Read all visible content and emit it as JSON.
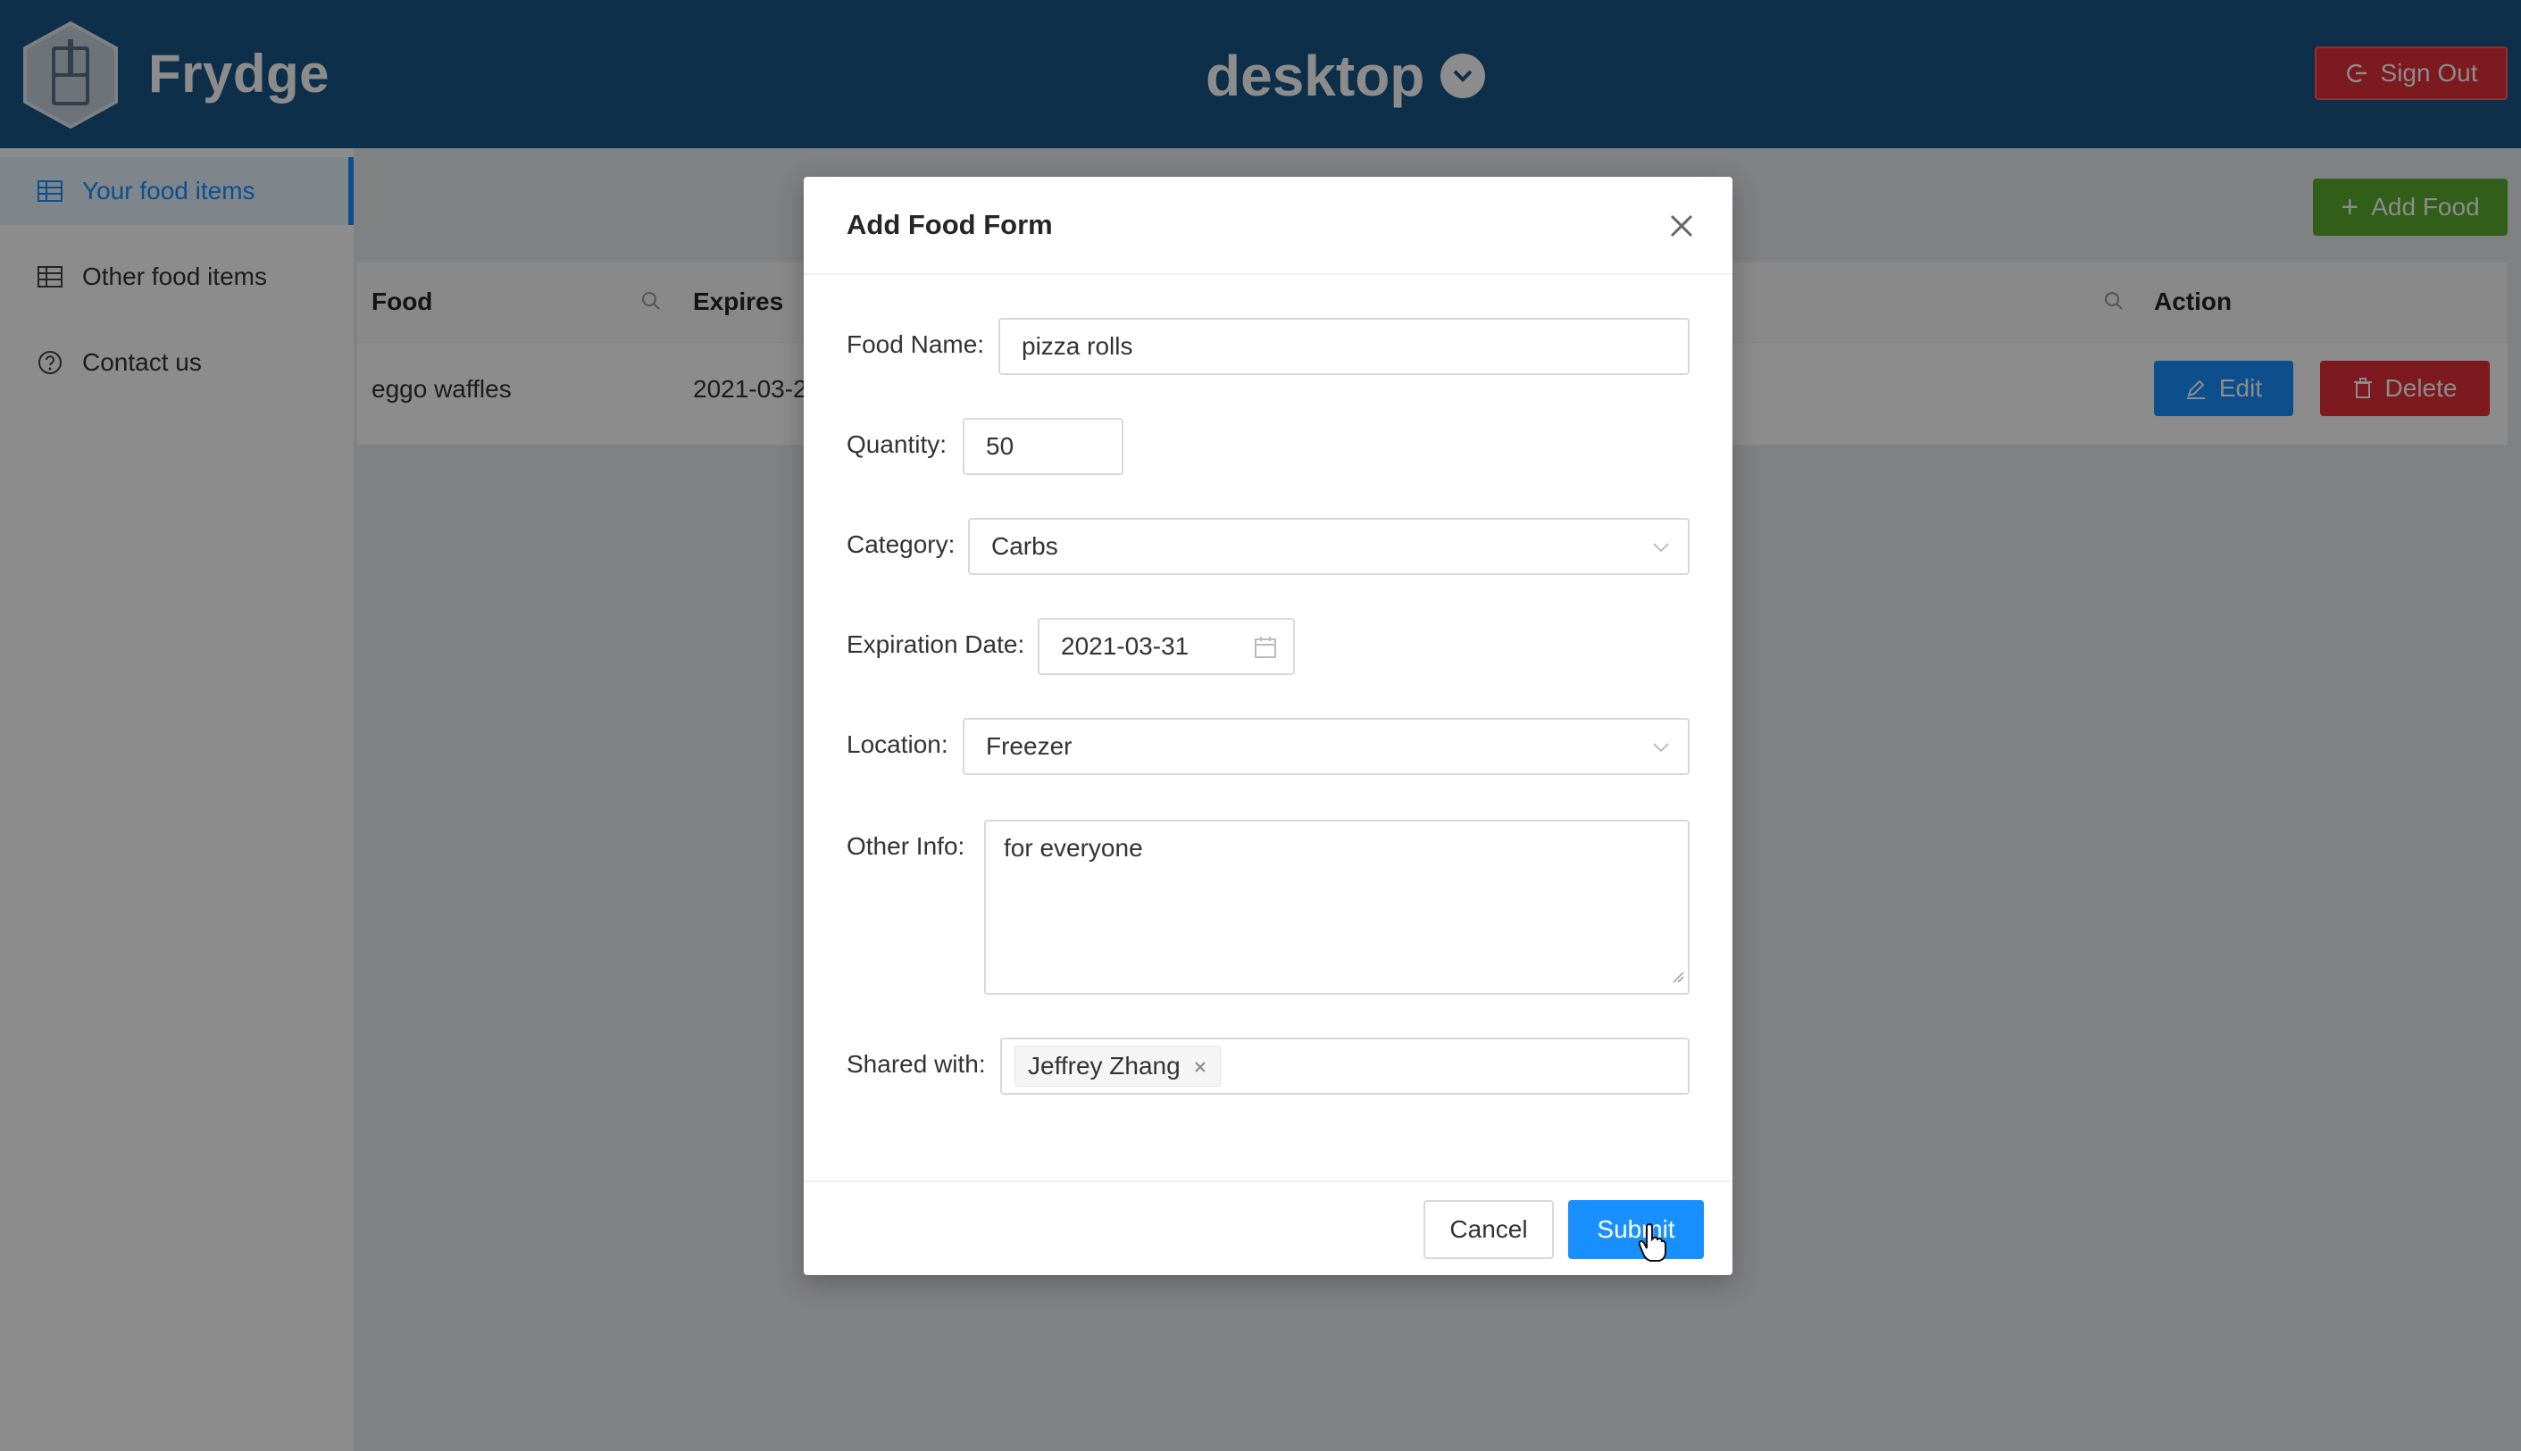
{
  "header": {
    "brand": "Frydge",
    "workspace": "desktop",
    "sign_out_label": "Sign Out"
  },
  "sidebar": {
    "items": [
      {
        "label": "Your food items",
        "icon": "table-icon",
        "active": true
      },
      {
        "label": "Other food items",
        "icon": "table-icon",
        "active": false
      },
      {
        "label": "Contact us",
        "icon": "question-circle-icon",
        "active": false
      }
    ]
  },
  "main": {
    "add_food_label": "Add Food",
    "table": {
      "columns": [
        "Food",
        "Expires",
        "Action"
      ],
      "rows": [
        {
          "food": "eggo waffles",
          "expires": "2021-03-2",
          "edit_label": "Edit",
          "delete_label": "Delete"
        }
      ]
    }
  },
  "modal": {
    "title": "Add Food Form",
    "fields": {
      "food_name": {
        "label": "Food Name",
        "value": "pizza rolls"
      },
      "quantity": {
        "label": "Quantity",
        "value": "50"
      },
      "category": {
        "label": "Category",
        "value": "Carbs"
      },
      "expiration_date": {
        "label": "Expiration Date",
        "value": "2021-03-31"
      },
      "location": {
        "label": "Location",
        "value": "Freezer"
      },
      "other_info": {
        "label": "Other Info",
        "value": "for everyone"
      },
      "shared_with": {
        "label": "Shared with",
        "tags": [
          "Jeffrey Zhang"
        ]
      }
    },
    "cancel_label": "Cancel",
    "submit_label": "Submit"
  },
  "colors": {
    "header": "#1b5686",
    "primary": "#1890ff",
    "danger": "#e2313a",
    "success": "#5aad2f"
  }
}
